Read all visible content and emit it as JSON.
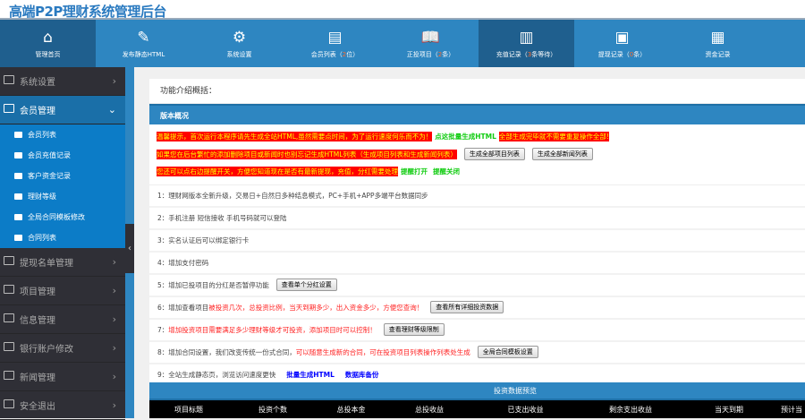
{
  "header": {
    "title": "高端P2P理财系统管理后台"
  },
  "nav": [
    {
      "icon": "home-icon",
      "glyph": "⌂",
      "label": "管理首页"
    },
    {
      "icon": "edit-icon",
      "glyph": "✎",
      "label": "发布静态HTML"
    },
    {
      "icon": "gear-icon",
      "glyph": "⚙",
      "label": "系统设置"
    },
    {
      "icon": "list-icon",
      "glyph": "▤",
      "label": "会员列表（",
      "hl": "2",
      "tail": "位）"
    },
    {
      "icon": "book-icon",
      "glyph": "📖",
      "label": "正投项目（",
      "hl": "2",
      "tail": "条）"
    },
    {
      "icon": "coins-icon",
      "glyph": "▥",
      "label": "充值记录（",
      "hl": "3",
      "tail": "条等待）"
    },
    {
      "icon": "save-icon",
      "glyph": "▣",
      "label": "提现记录（",
      "hl": "0",
      "tail": "条）"
    },
    {
      "icon": "calculator-icon",
      "glyph": "▦",
      "label": "资金记录"
    }
  ],
  "sidebar": {
    "items": [
      "系统设置",
      "会员管理",
      "提现名单管理",
      "项目管理",
      "信息管理",
      "银行账户修改",
      "新闻管理",
      "安全退出"
    ],
    "subitems": [
      "会员列表",
      "会员充值记录",
      "客户资金记录",
      "理财等级",
      "全局合同模板修改",
      "合同列表"
    ],
    "collapse": "‹"
  },
  "main": {
    "title": "功能介绍概括：",
    "section": "版本概况",
    "alert1": {
      "red": "温馨提示，首次运行本程序请先生成全站HTML,虽然需要点时间，为了运行速度何乐而不为！",
      "link": "点这批量生成HTML",
      "red2": "全部生成完毕就不需要重复操作全部!"
    },
    "alert2": {
      "red": "如果您在后台繁忙的添加删除项目或新闻时也别忘记生成HTML列表（生成项目列表和生成新闻列表）",
      "btn1": "生成全部项目列表",
      "btn2": "生成全部新闻列表"
    },
    "alert3": {
      "red": "您还可以点右边提醒开关，方便您知道现在是否有最新提现，充值，分红需要处理",
      "on": "提醒打开",
      "off": "提醒关闭"
    },
    "rows": [
      {
        "n": "1：",
        "t": "理财网版本全新升级，交易日+自然日多种结息模式，PC+手机+APP多端平台数据同步"
      },
      {
        "n": "2：",
        "t": "手机注册 短信接收 手机号码就可以登陆"
      },
      {
        "n": "3：",
        "t": "实名认证后可以绑定银行卡"
      },
      {
        "n": "4：",
        "t": "增加支付密码"
      },
      {
        "n": "5：",
        "t": "增加已投项目的分红是否暂停功能",
        "btn": "查看单个分红设置"
      },
      {
        "n": "6：",
        "t": "增加查看项目",
        "r": "被投资几次，总投资比例，当天到期多少，出入资金多少，方便您查询！",
        "btn": "查看所有详细投资数据"
      },
      {
        "n": "7：",
        "r": "增加投资项目需要满足多少理财等级才可投资，添加项目时可以控制！",
        "btn": "查看理财等级限制"
      },
      {
        "n": "8：",
        "t": "增加合同设置，我们改变传统一份式合同，",
        "r": "可以随意生成新的合同，可在投资项目列表操作列表处生成",
        "btn": "全局合同模板设置"
      },
      {
        "n": "9：",
        "t": "全站生成静态页，浏览访问速度更快",
        "l1": "批量生成HTML",
        "l2": "数据库备份"
      }
    ],
    "preview": "投资数据预览",
    "columns": [
      "项目标题",
      "投资个数",
      "总投本金",
      "总投收益",
      "已支出收益",
      "剩余支出收益",
      "当天到期",
      "预计当"
    ]
  }
}
